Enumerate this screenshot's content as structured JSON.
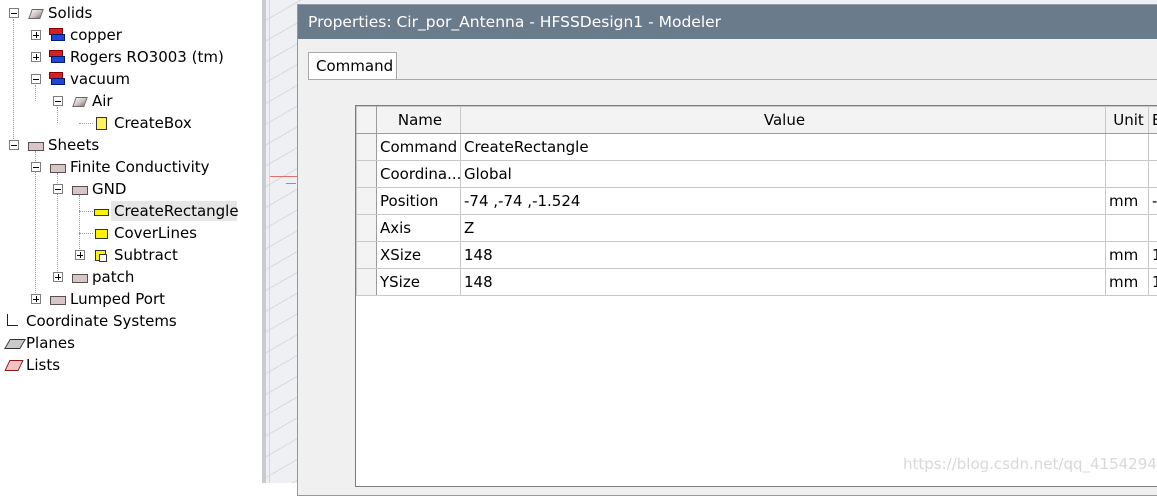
{
  "tree": {
    "items": [
      {
        "label": "Solids",
        "icon": "solid-icon",
        "expanded": true
      },
      {
        "label": "copper",
        "icon": "material-icon",
        "expanded": false
      },
      {
        "label": "Rogers RO3003 (tm)",
        "icon": "material-icon",
        "expanded": false
      },
      {
        "label": "vacuum",
        "icon": "material-icon",
        "expanded": true
      },
      {
        "label": "Air",
        "icon": "solid-icon",
        "expanded": true
      },
      {
        "label": "CreateBox",
        "icon": "box-icon"
      },
      {
        "label": "Sheets",
        "icon": "sheet-icon",
        "expanded": true
      },
      {
        "label": "Finite Conductivity",
        "icon": "sheet-icon",
        "expanded": true
      },
      {
        "label": "GND",
        "icon": "sheet-icon",
        "expanded": true
      },
      {
        "label": "CreateRectangle",
        "icon": "rectangle-icon",
        "selected": true
      },
      {
        "label": "CoverLines",
        "icon": "coverlines-icon"
      },
      {
        "label": "Subtract",
        "icon": "subtract-icon",
        "expanded": false
      },
      {
        "label": "patch",
        "icon": "sheet-icon",
        "expanded": false
      },
      {
        "label": "Lumped Port",
        "icon": "sheet-icon",
        "expanded": false
      },
      {
        "label": "Coordinate Systems",
        "icon": "coordinate-icon"
      },
      {
        "label": "Planes",
        "icon": "planes-icon"
      },
      {
        "label": "Lists",
        "icon": "lists-icon"
      }
    ]
  },
  "dialog": {
    "title": "Properties: Cir_por_Antenna - HFSSDesign1 - Modeler",
    "tabs": [
      {
        "label": "Command",
        "active": true
      }
    ]
  },
  "table": {
    "columns": [
      "Name",
      "Value",
      "Unit",
      "E"
    ],
    "rows": [
      {
        "name": "Command",
        "value": "CreateRectangle",
        "unit": "",
        "extra": ""
      },
      {
        "name": "Coordina...",
        "value": "Global",
        "unit": "",
        "extra": ""
      },
      {
        "name": "Position",
        "value": "-74 ,-74 ,-1.524",
        "unit": "mm",
        "extra": "-"
      },
      {
        "name": "Axis",
        "value": "Z",
        "unit": "",
        "extra": ""
      },
      {
        "name": "XSize",
        "value": "148",
        "unit": "mm",
        "extra": "1"
      },
      {
        "name": "YSize",
        "value": "148",
        "unit": "mm",
        "extra": "1"
      }
    ]
  },
  "watermark": "https://blog.csdn.net/qq_41542947",
  "colors": {
    "titlebar": "#6a7b8c",
    "selection": "#e6e6e6"
  }
}
